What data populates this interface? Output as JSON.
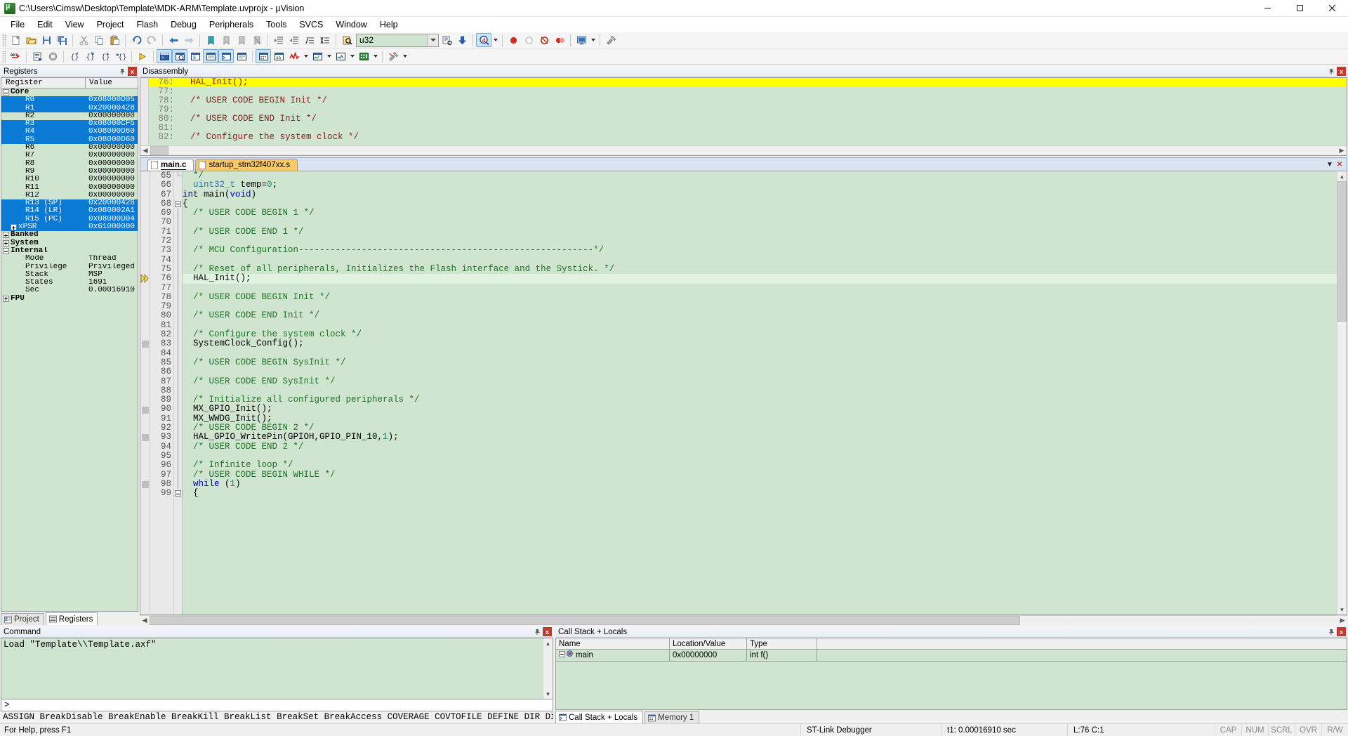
{
  "window": {
    "title": "C:\\Users\\Cimsw\\Desktop\\Template\\MDK-ARM\\Template.uvprojx - µVision",
    "minimize_label": "Minimize",
    "maximize_label": "Maximize",
    "close_label": "Close"
  },
  "menu": {
    "items": [
      "File",
      "Edit",
      "View",
      "Project",
      "Flash",
      "Debug",
      "Peripherals",
      "Tools",
      "SVCS",
      "Window",
      "Help"
    ]
  },
  "toolbar1": {
    "search_value": "u32",
    "search_placeholder": "",
    "icons": [
      "new-file-icon",
      "open-file-icon",
      "save-icon",
      "save-all-icon",
      "cut-icon",
      "copy-icon",
      "paste-icon",
      "undo-icon",
      "redo-icon",
      "navigate-back-icon",
      "navigate-forward-icon",
      "bookmark-toggle-icon",
      "bookmark-prev-icon",
      "bookmark-next-icon",
      "bookmark-clear-icon",
      "indent-right-icon",
      "indent-left-icon",
      "comment-icon",
      "uncomment-icon",
      "find-in-files-icon"
    ],
    "after_search_icons": [
      "insert-file-icon",
      "download-icon",
      "debug-find-icon",
      "stop-icon",
      "reset-run-icon",
      "breakpoint-icon"
    ]
  },
  "toolbar2": {
    "icons": [
      "reset-cpu-icon",
      "run-icon",
      "stop-debug-icon",
      "step-into-icon",
      "step-over-icon",
      "step-out-icon",
      "run-to-cursor-icon",
      "show-statement-icon",
      "command-window-icon",
      "disassembly-window-icon",
      "symbols-window-icon",
      "registers-window-icon",
      "call-stack-icon",
      "watch-window-icon",
      "memory-window-icon",
      "serial-window-icon",
      "analysis-window-icon",
      "trace-window-icon",
      "system-viewer-icon",
      "toolbox-icon"
    ]
  },
  "registers": {
    "pane_title": "Registers",
    "pin_icon": "pin-icon",
    "close_icon": "close-icon",
    "columns": [
      "Register",
      "Value"
    ],
    "rows": [
      {
        "name": "Core",
        "value": "",
        "indent": 0,
        "twisty": "minus",
        "selected": false,
        "bold": true
      },
      {
        "name": "R0",
        "value": "0x08000D05",
        "indent": 2,
        "twisty": "none",
        "selected": true
      },
      {
        "name": "R1",
        "value": "0x20000428",
        "indent": 2,
        "twisty": "none",
        "selected": true
      },
      {
        "name": "R2",
        "value": "0x00000000",
        "indent": 2,
        "twisty": "none",
        "selected": false
      },
      {
        "name": "R3",
        "value": "0x08000CF5",
        "indent": 2,
        "twisty": "none",
        "selected": true
      },
      {
        "name": "R4",
        "value": "0x08000D60",
        "indent": 2,
        "twisty": "none",
        "selected": true
      },
      {
        "name": "R5",
        "value": "0x08000D60",
        "indent": 2,
        "twisty": "none",
        "selected": true
      },
      {
        "name": "R6",
        "value": "0x00000000",
        "indent": 2,
        "twisty": "none",
        "selected": false
      },
      {
        "name": "R7",
        "value": "0x00000000",
        "indent": 2,
        "twisty": "none",
        "selected": false
      },
      {
        "name": "R8",
        "value": "0x00000000",
        "indent": 2,
        "twisty": "none",
        "selected": false
      },
      {
        "name": "R9",
        "value": "0x00000000",
        "indent": 2,
        "twisty": "none",
        "selected": false
      },
      {
        "name": "R10",
        "value": "0x00000000",
        "indent": 2,
        "twisty": "none",
        "selected": false
      },
      {
        "name": "R11",
        "value": "0x00000000",
        "indent": 2,
        "twisty": "none",
        "selected": false
      },
      {
        "name": "R12",
        "value": "0x00000000",
        "indent": 2,
        "twisty": "none",
        "selected": false
      },
      {
        "name": "R13 (SP)",
        "value": "0x20000428",
        "indent": 2,
        "twisty": "none",
        "selected": true
      },
      {
        "name": "R14 (LR)",
        "value": "0x080002A1",
        "indent": 2,
        "twisty": "none",
        "selected": true
      },
      {
        "name": "R15 (PC)",
        "value": "0x08000D04",
        "indent": 2,
        "twisty": "none",
        "selected": true
      },
      {
        "name": "xPSR",
        "value": "0x61000000",
        "indent": 1,
        "twisty": "plus",
        "selected": true
      },
      {
        "name": "Banked",
        "value": "",
        "indent": 0,
        "twisty": "plus",
        "selected": false,
        "bold": true
      },
      {
        "name": "System",
        "value": "",
        "indent": 0,
        "twisty": "plus",
        "selected": false,
        "bold": true
      },
      {
        "name": "Internal",
        "value": "",
        "indent": 0,
        "twisty": "minus",
        "selected": false,
        "bold": true
      },
      {
        "name": "Mode",
        "value": "Thread",
        "indent": 2,
        "twisty": "none",
        "selected": false
      },
      {
        "name": "Privilege",
        "value": "Privileged",
        "indent": 2,
        "twisty": "none",
        "selected": false
      },
      {
        "name": "Stack",
        "value": "MSP",
        "indent": 2,
        "twisty": "none",
        "selected": false
      },
      {
        "name": "States",
        "value": "1691",
        "indent": 2,
        "twisty": "none",
        "selected": false
      },
      {
        "name": "Sec",
        "value": "0.00016910",
        "indent": 2,
        "twisty": "none",
        "selected": false
      },
      {
        "name": "FPU",
        "value": "",
        "indent": 0,
        "twisty": "plus",
        "selected": false,
        "bold": true
      }
    ]
  },
  "left_tabs": [
    {
      "label": "Project",
      "icon": "project-icon",
      "active": false
    },
    {
      "label": "Registers",
      "icon": "registers-icon",
      "active": true
    }
  ],
  "disassembly": {
    "pane_title": "Disassembly",
    "pin_icon": "pin-icon",
    "close_icon": "close-icon",
    "lines": [
      {
        "num": "76:",
        "text": "  HAL_Init();",
        "highlight": true
      },
      {
        "num": "77:",
        "text": "",
        "highlight": false
      },
      {
        "num": "78:",
        "text": "  /* USER CODE BEGIN Init */",
        "highlight": false
      },
      {
        "num": "79:",
        "text": "",
        "highlight": false
      },
      {
        "num": "80:",
        "text": "  /* USER CODE END Init */",
        "highlight": false
      },
      {
        "num": "81:",
        "text": "",
        "highlight": false
      },
      {
        "num": "82:",
        "text": "  /* Configure the system clock */",
        "highlight": false
      }
    ]
  },
  "editor": {
    "tabs": [
      {
        "label": "main.c",
        "active": true,
        "color": "white"
      },
      {
        "label": "startup_stm32f407xx.s",
        "active": false,
        "color": "orange"
      }
    ],
    "tab_menu_icon": "chevron-down-icon",
    "tab_close_icon": "close-icon",
    "lines": [
      {
        "num": "65",
        "current": false,
        "marker": "none",
        "fold": "end",
        "spans": [
          {
            "t": "  */",
            "c": "c-com"
          }
        ]
      },
      {
        "num": "66",
        "current": false,
        "marker": "none",
        "fold": "none",
        "spans": [
          {
            "t": "  ",
            "c": "c-txt"
          },
          {
            "t": "uint32_t",
            "c": "c-type"
          },
          {
            "t": " temp=",
            "c": "c-txt"
          },
          {
            "t": "0",
            "c": "c-num"
          },
          {
            "t": ";",
            "c": "c-txt"
          }
        ]
      },
      {
        "num": "67",
        "current": false,
        "marker": "none",
        "fold": "none",
        "spans": [
          {
            "t": "int",
            "c": "c-kw"
          },
          {
            "t": " main(",
            "c": "c-txt"
          },
          {
            "t": "void",
            "c": "c-kw"
          },
          {
            "t": ")",
            "c": "c-txt"
          }
        ]
      },
      {
        "num": "68",
        "current": false,
        "marker": "none",
        "fold": "start",
        "spans": [
          {
            "t": "{",
            "c": "c-txt"
          }
        ]
      },
      {
        "num": "69",
        "current": false,
        "marker": "none",
        "fold": "bar",
        "spans": [
          {
            "t": "  /* USER CODE BEGIN 1 */",
            "c": "c-com"
          }
        ]
      },
      {
        "num": "70",
        "current": false,
        "marker": "none",
        "fold": "bar",
        "spans": []
      },
      {
        "num": "71",
        "current": false,
        "marker": "none",
        "fold": "bar",
        "spans": [
          {
            "t": "  /* USER CODE END 1 */",
            "c": "c-com"
          }
        ]
      },
      {
        "num": "72",
        "current": false,
        "marker": "none",
        "fold": "bar",
        "spans": []
      },
      {
        "num": "73",
        "current": false,
        "marker": "none",
        "fold": "bar",
        "spans": [
          {
            "t": "  /* MCU Configuration--------------------------------------------------------*/",
            "c": "c-com"
          }
        ]
      },
      {
        "num": "74",
        "current": false,
        "marker": "none",
        "fold": "bar",
        "spans": []
      },
      {
        "num": "75",
        "current": false,
        "marker": "none",
        "fold": "bar",
        "spans": [
          {
            "t": "  /* Reset of all peripherals, Initializes the Flash interface and the Systick. */",
            "c": "c-com"
          }
        ]
      },
      {
        "num": "76",
        "current": true,
        "marker": "arrow",
        "fold": "bar",
        "spans": [
          {
            "t": "  HAL_Init();",
            "c": "c-txt"
          }
        ]
      },
      {
        "num": "77",
        "current": false,
        "marker": "none",
        "fold": "bar",
        "spans": []
      },
      {
        "num": "78",
        "current": false,
        "marker": "none",
        "fold": "bar",
        "spans": [
          {
            "t": "  /* USER CODE BEGIN Init */",
            "c": "c-com"
          }
        ]
      },
      {
        "num": "79",
        "current": false,
        "marker": "none",
        "fold": "bar",
        "spans": []
      },
      {
        "num": "80",
        "current": false,
        "marker": "none",
        "fold": "bar",
        "spans": [
          {
            "t": "  /* USER CODE END Init */",
            "c": "c-com"
          }
        ]
      },
      {
        "num": "81",
        "current": false,
        "marker": "none",
        "fold": "bar",
        "spans": []
      },
      {
        "num": "82",
        "current": false,
        "marker": "none",
        "fold": "bar",
        "spans": [
          {
            "t": "  /* Configure the system clock */",
            "c": "c-com"
          }
        ]
      },
      {
        "num": "83",
        "current": false,
        "marker": "bp",
        "fold": "bar",
        "spans": [
          {
            "t": "  SystemClock_Config();",
            "c": "c-txt"
          }
        ]
      },
      {
        "num": "84",
        "current": false,
        "marker": "none",
        "fold": "bar",
        "spans": []
      },
      {
        "num": "85",
        "current": false,
        "marker": "none",
        "fold": "bar",
        "spans": [
          {
            "t": "  /* USER CODE BEGIN SysInit */",
            "c": "c-com"
          }
        ]
      },
      {
        "num": "86",
        "current": false,
        "marker": "none",
        "fold": "bar",
        "spans": []
      },
      {
        "num": "87",
        "current": false,
        "marker": "none",
        "fold": "bar",
        "spans": [
          {
            "t": "  /* USER CODE END SysInit */",
            "c": "c-com"
          }
        ]
      },
      {
        "num": "88",
        "current": false,
        "marker": "none",
        "fold": "bar",
        "spans": []
      },
      {
        "num": "89",
        "current": false,
        "marker": "none",
        "fold": "bar",
        "spans": [
          {
            "t": "  /* Initialize all configured peripherals */",
            "c": "c-com"
          }
        ]
      },
      {
        "num": "90",
        "current": false,
        "marker": "bp",
        "fold": "bar",
        "spans": [
          {
            "t": "  MX_GPIO_Init();",
            "c": "c-txt"
          }
        ]
      },
      {
        "num": "91",
        "current": false,
        "marker": "none",
        "fold": "bar",
        "spans": [
          {
            "t": "  MX_WWDG_Init();",
            "c": "c-txt"
          }
        ]
      },
      {
        "num": "92",
        "current": false,
        "marker": "none",
        "fold": "bar",
        "spans": [
          {
            "t": "  /* USER CODE BEGIN 2 */",
            "c": "c-com"
          }
        ]
      },
      {
        "num": "93",
        "current": false,
        "marker": "bp",
        "fold": "bar",
        "spans": [
          {
            "t": "  HAL_GPIO_WritePin(GPIOH,GPIO_PIN_10,",
            "c": "c-txt"
          },
          {
            "t": "1",
            "c": "c-num"
          },
          {
            "t": ");",
            "c": "c-txt"
          }
        ]
      },
      {
        "num": "94",
        "current": false,
        "marker": "none",
        "fold": "bar",
        "spans": [
          {
            "t": "  /* USER CODE END 2 */",
            "c": "c-com"
          }
        ]
      },
      {
        "num": "95",
        "current": false,
        "marker": "none",
        "fold": "bar",
        "spans": []
      },
      {
        "num": "96",
        "current": false,
        "marker": "none",
        "fold": "bar",
        "spans": [
          {
            "t": "  /* Infinite loop */",
            "c": "c-com"
          }
        ]
      },
      {
        "num": "97",
        "current": false,
        "marker": "none",
        "fold": "bar",
        "spans": [
          {
            "t": "  /* USER CODE BEGIN WHILE */",
            "c": "c-com"
          }
        ]
      },
      {
        "num": "98",
        "current": false,
        "marker": "bp",
        "fold": "bar",
        "spans": [
          {
            "t": "  ",
            "c": "c-txt"
          },
          {
            "t": "while",
            "c": "c-kw"
          },
          {
            "t": " (",
            "c": "c-txt"
          },
          {
            "t": "1",
            "c": "c-num"
          },
          {
            "t": ")",
            "c": "c-txt"
          }
        ]
      },
      {
        "num": "99",
        "current": false,
        "marker": "none",
        "fold": "start",
        "spans": [
          {
            "t": "  {",
            "c": "c-txt"
          }
        ]
      }
    ]
  },
  "command": {
    "pane_title": "Command",
    "pin_icon": "pin-icon",
    "close_icon": "close-icon",
    "output": "Load \"Template\\\\Template.axf\"",
    "prompt": ">",
    "input_value": "",
    "keywords": "ASSIGN BreakDisable BreakEnable BreakKill BreakList BreakSet BreakAccess COVERAGE COVTOFILE DEFINE DIR Display Enter"
  },
  "callstack": {
    "pane_title": "Call Stack + Locals",
    "pin_icon": "pin-icon",
    "close_icon": "close-icon",
    "columns": [
      "Name",
      "Location/Value",
      "Type"
    ],
    "rows": [
      {
        "name": "main",
        "location": "0x00000000",
        "type": "int f()",
        "icon": "function-icon",
        "twisty": "minus"
      }
    ],
    "tabs": [
      {
        "label": "Call Stack + Locals",
        "icon": "callstack-icon",
        "active": true
      },
      {
        "label": "Memory 1",
        "icon": "memory-icon",
        "active": false
      }
    ]
  },
  "statusbar": {
    "help_text": "For Help, press F1",
    "debugger": "ST-Link Debugger",
    "time": "t1: 0.00016910 sec",
    "position": "L:76 C:1",
    "flags": [
      "CAP",
      "NUM",
      "SCRL",
      "OVR",
      "R/W"
    ]
  },
  "colors": {
    "code_bg": "#cfe5cf",
    "highlight_yellow": "#ffff00",
    "current_line": "#e2f3e2",
    "selection_blue": "#0a7ad4",
    "comment_green": "#1d7324",
    "keyword_blue": "#0000cc",
    "tab_orange": "#fcc96a"
  }
}
